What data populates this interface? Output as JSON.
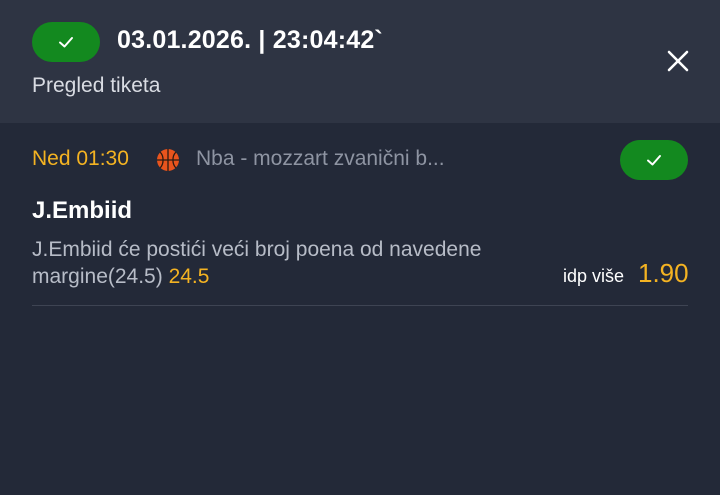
{
  "header": {
    "status_icon": "check-icon",
    "datetime": "03.01.2026. | 23:04:42`",
    "subtitle": "Pregled tiketa",
    "close_icon": "close-icon"
  },
  "event": {
    "time": "Ned 01:30",
    "sport_icon": "basketball-icon",
    "league": "Nba - mozzart zvanični b...",
    "result_icon": "check-icon",
    "player": "J.Embiid",
    "description": "J.Embiid će postići veći broj poena od navedene margine(24.5)",
    "line": "24.5",
    "pick": "idp više",
    "odds": "1.90"
  },
  "colors": {
    "background": "#232938",
    "header_bg": "#2e3443",
    "success": "#13891f",
    "accent": "#f4b322"
  }
}
